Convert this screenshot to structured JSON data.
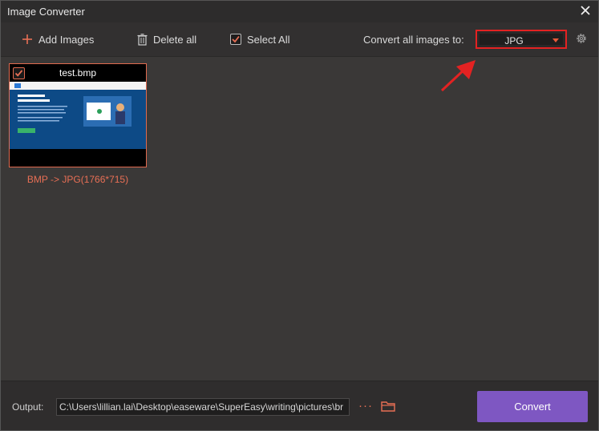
{
  "window": {
    "title": "Image Converter"
  },
  "toolbar": {
    "add_images": "Add Images",
    "delete_all": "Delete all",
    "select_all": "Select All",
    "select_all_checked": true,
    "convert_all_label": "Convert all images to:",
    "format_value": "JPG"
  },
  "images": [
    {
      "name": "test.bmp",
      "checked": true,
      "caption": "BMP -> JPG(1766*715)"
    }
  ],
  "footer": {
    "output_label": "Output:",
    "output_path": "C:\\Users\\lillian.lai\\Desktop\\easeware\\SuperEasy\\writing\\pictures\\br",
    "more_label": "···",
    "convert_label": "Convert"
  },
  "colors": {
    "accent": "#e86f55",
    "convert_button": "#7e57c2",
    "highlight_box": "#e32222"
  }
}
